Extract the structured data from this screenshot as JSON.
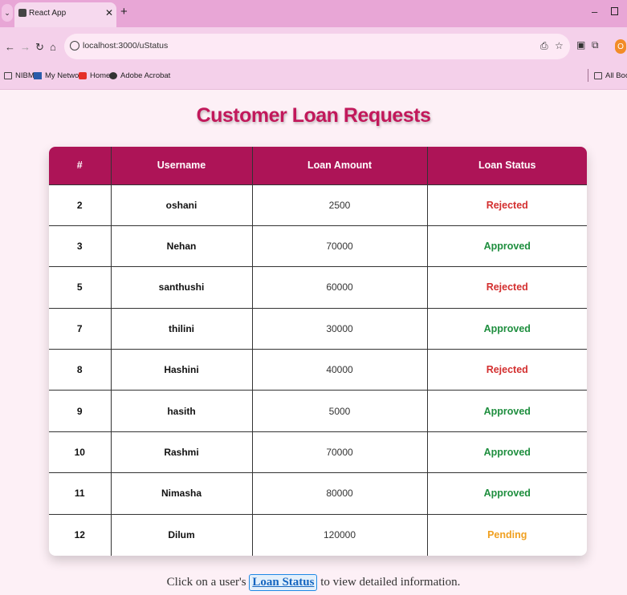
{
  "browser": {
    "tab_title": "React App",
    "url": "localhost:3000/uStatus",
    "bookmarks": [
      "NIBM",
      "My Network",
      "Home",
      "Adobe Acrobat"
    ],
    "all_bookmarks": "All Bookm",
    "profile_initial": "O"
  },
  "page": {
    "title": "Customer Loan Requests",
    "columns": [
      "#",
      "Username",
      "Loan Amount",
      "Loan Status"
    ],
    "status_colors": {
      "Rejected": "#d32f2f",
      "Approved": "#1e8e3e",
      "Pending": "#f0a020"
    },
    "rows": [
      {
        "id": "2",
        "username": "oshani",
        "amount": "2500",
        "status": "Rejected"
      },
      {
        "id": "3",
        "username": "Nehan",
        "amount": "70000",
        "status": "Approved"
      },
      {
        "id": "5",
        "username": "santhushi",
        "amount": "60000",
        "status": "Rejected"
      },
      {
        "id": "7",
        "username": "thilini",
        "amount": "30000",
        "status": "Approved"
      },
      {
        "id": "8",
        "username": "Hashini",
        "amount": "40000",
        "status": "Rejected"
      },
      {
        "id": "9",
        "username": "hasith",
        "amount": "5000",
        "status": "Approved"
      },
      {
        "id": "10",
        "username": "Rashmi",
        "amount": "70000",
        "status": "Approved"
      },
      {
        "id": "11",
        "username": "Nimasha",
        "amount": "80000",
        "status": "Approved"
      },
      {
        "id": "12",
        "username": "Dilum",
        "amount": "120000",
        "status": "Pending"
      }
    ],
    "footer_before": "Click on a user's",
    "footer_link": "Loan Status",
    "footer_after": "to view detailed information."
  }
}
